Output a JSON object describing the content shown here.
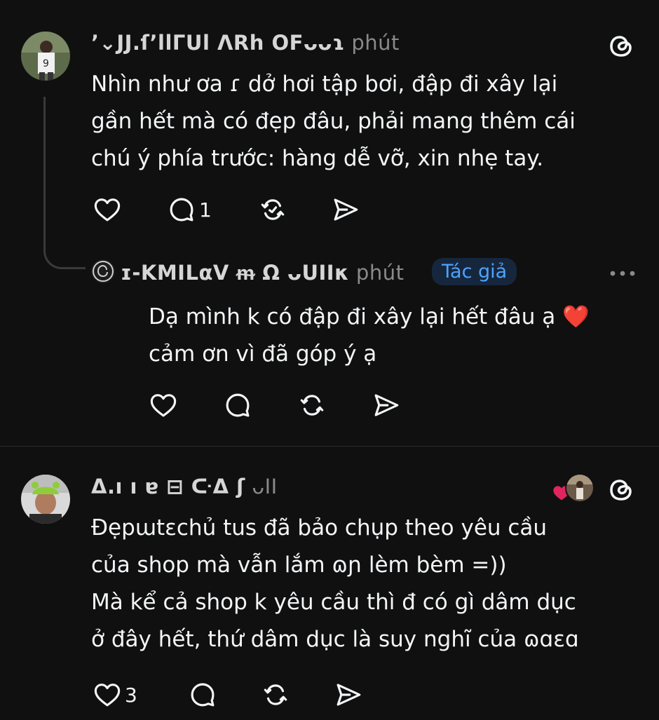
{
  "post1": {
    "username": "ʼ⌄JJ.ſʼllΓUl ΛRh OFᴗᴗɿ",
    "time": "phút",
    "text_lines": [
      "Nhìn như ơa ɾ dở hơi tập bơi, đập đi xây lại",
      "gần hết mà có đẹp đâu, phải mang thêm cái",
      "chú ý phía trước: hàng dễ vỡ, xin nhẹ tay."
    ],
    "reply_count": "1",
    "icons": {
      "like": "heart-outline-icon",
      "reply": "speech-bubble-icon",
      "repost": "repost-icon",
      "share": "send-icon",
      "brand": "threads-logo-icon"
    }
  },
  "reply": {
    "username": "ɪ-ΚΜΙLαV ᵯ Ω ᴗUΙΙκ",
    "time": "phút",
    "author_badge": "Tác giả",
    "text_lines": [
      "Dạ mình k có đập đi xây lại hết đâu ạ",
      "cảm ơn vì đã góp ý ạ"
    ],
    "emoji": "❤️"
  },
  "post2": {
    "username": "ᐃ.ı ı ɐ ⊟ ᑢᐃ ʃ",
    "time": "ᴗΙΙ",
    "text_lines": [
      "Đẹpɯtɛchủ tus đã bảo chụp theo yêu cầu",
      "của shop mà vẫn lắm ɷɲ lèm bèm =))",
      "Mà kể cả shop k yêu cầu thì đ có gì dâm dục",
      "ở đây hết, thứ dâm dục là suy nghĩ của ɷɑɛɑ"
    ],
    "like_count": "3"
  },
  "colors": {
    "background": "#101010",
    "text": "#f3f5f7",
    "muted": "#8a8a8a",
    "badge_bg": "#16273d",
    "badge_text": "#4ea3ff",
    "heart": "#e0245e"
  }
}
